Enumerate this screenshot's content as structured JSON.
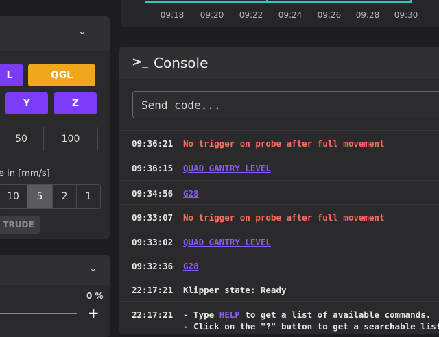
{
  "chart": {
    "line_color": "#33c7c4",
    "x_ticks": [
      "09:18",
      "09:20",
      "09:22",
      "09:24",
      "09:26",
      "09:28",
      "09:30"
    ]
  },
  "left_panel": {
    "buttons": {
      "home_all_partial": "L",
      "qgl": "QGL",
      "home_y": "Y",
      "home_z": "Z"
    },
    "distance_options": [
      "50",
      "100"
    ],
    "speed_label": "e in [mm/s]",
    "speed_options": [
      {
        "label": "10",
        "active": false
      },
      {
        "label": "5",
        "active": true
      },
      {
        "label": "2",
        "active": false
      },
      {
        "label": "1",
        "active": false
      }
    ],
    "extrude_label": "TRUDE",
    "second_panel_value": "0 %",
    "plus_label": "+"
  },
  "console": {
    "icon": "terminal-icon",
    "title": "Console",
    "input_placeholder": "Send code...",
    "entries": [
      {
        "time": "09:36:21",
        "text": "No trigger on probe after full movement",
        "type": "error"
      },
      {
        "time": "09:36:15",
        "text": "QUAD_GANTRY_LEVEL",
        "type": "cmd"
      },
      {
        "time": "09:34:56",
        "text": "G28",
        "type": "cmd"
      },
      {
        "time": "09:33:07",
        "text": "No trigger on probe after full movement",
        "type": "error"
      },
      {
        "time": "09:33:02",
        "text": "QUAD_GANTRY_LEVEL",
        "type": "cmd"
      },
      {
        "time": "09:32:36",
        "text": "G28",
        "type": "cmd"
      },
      {
        "time": "22:17:21",
        "text": "Klipper state: Ready",
        "type": "normal"
      }
    ],
    "help_entry": {
      "time": "22:17:21",
      "prefix": "- Type ",
      "keyword": "HELP",
      "suffix": " to get a list of available commands.",
      "line2": "- Click on the \"?\" button to get a searchable list."
    }
  },
  "colors": {
    "accent_purple": "#7a3cf5",
    "accent_orange": "#f0a81b",
    "error_red": "#ff6b5c",
    "command_purple": "#8b5cf6"
  }
}
